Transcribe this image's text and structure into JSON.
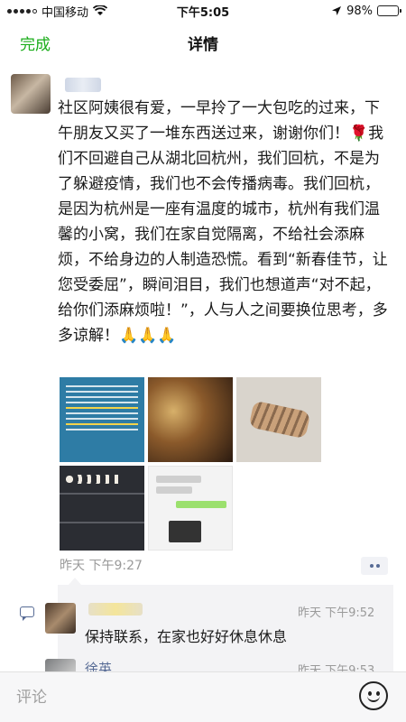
{
  "status_bar": {
    "carrier": "中国移动",
    "time": "下午5:05",
    "battery": "98%",
    "battery_level": 0.98
  },
  "nav": {
    "done_label": "完成",
    "title": "详情"
  },
  "post": {
    "text": "社区阿姨很有爱，一早拎了一大包吃的过来，下午朋友又买了一堆东西送过来，谢谢你们！🌹我们不回避自己从湖北回杭州，我们回杭，不是为了躲避疫情，我们也不会传播病毒。我们回杭，是因为杭州是一座有温度的城市，杭州有我们温馨的小窝，我们在家自觉隔离，不给社会添麻烦，不给身边的人制造恐慌。看到“新春佳节，让您受委屈”，瞬间泪目，我们也想道声“对不起，给你们添麻烦啦！”，人与人之间要换位思考，多多谅解！🙏🙏🙏",
    "time": "昨天 下午9:27"
  },
  "comments": [
    {
      "time": "昨天 下午9:52",
      "text": "保持联系，在家也好好休息休息"
    },
    {
      "name": "徐英",
      "time": "昨天 下午9:53"
    }
  ],
  "bottom_bar": {
    "placeholder": "评论"
  }
}
